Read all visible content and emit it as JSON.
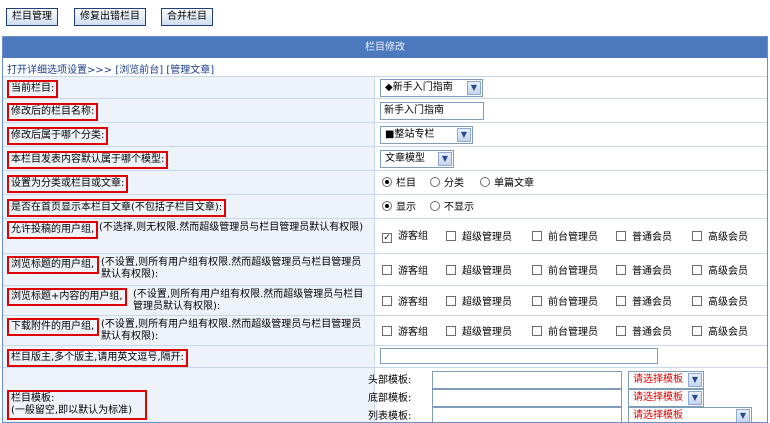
{
  "toolbar": {
    "manage": "栏目管理",
    "repair": "修复出错栏目",
    "merge": "合并栏目"
  },
  "header": {
    "title": "栏目修改"
  },
  "breadcrumb": {
    "open_detail": "打开详细选项设置>>>",
    "preview": "[浏览前台]",
    "manage_article": "[管理文章]"
  },
  "rows": {
    "current": {
      "label": "当前栏目:",
      "value": "◆新手入门指南"
    },
    "name": {
      "label": "修改后的栏目名称:",
      "value": "新手入门指南"
    },
    "category": {
      "label": "修改后属于哪个分类:",
      "value": "■整站专栏"
    },
    "model": {
      "label": "本栏目发表内容默认属于哪个模型:",
      "value": "文章模型"
    },
    "type": {
      "label": "设置为分类或栏目或文章:",
      "options": [
        "栏目",
        "分类",
        "单篇文章"
      ]
    },
    "home": {
      "label": "是否在首页显示本栏目文章(不包括子栏目文章):",
      "options": [
        "显示",
        "不显示"
      ]
    },
    "post_groups": {
      "label": "允许投稿的用户组,",
      "note": "(不选择,则无权限.然而超级管理员与栏目管理员默认有权限)"
    },
    "view_title_groups": {
      "label": "浏览标题的用户组,",
      "note": "(不设置,则所有用户组有权限.然而超级管理员与栏目管理员默认有权限):"
    },
    "view_content_groups": {
      "label": "浏览标题+内容的用户组,",
      "note": "(不设置,则所有用户组有权限.然而超级管理员与栏目管理员默认有权限):"
    },
    "download_groups": {
      "label": "下载附件的用户组,",
      "note": "(不设置,则所有用户组有权限.然而超级管理员与栏目管理员默认有权限):"
    },
    "moderators": {
      "label": "栏目版主,多个版主,请用英文逗号,隔开:"
    },
    "templates": {
      "label": "栏目模板:",
      "sub": "(一般留空,即以默认为标准)",
      "head_label": "头部模板:",
      "foot_label": "底部模板:",
      "list_label": "列表模板:",
      "choose": "请选择模板"
    }
  },
  "groups": [
    "游客组",
    "超级管理员",
    "前台管理员",
    "普通会员",
    "高级会员"
  ]
}
